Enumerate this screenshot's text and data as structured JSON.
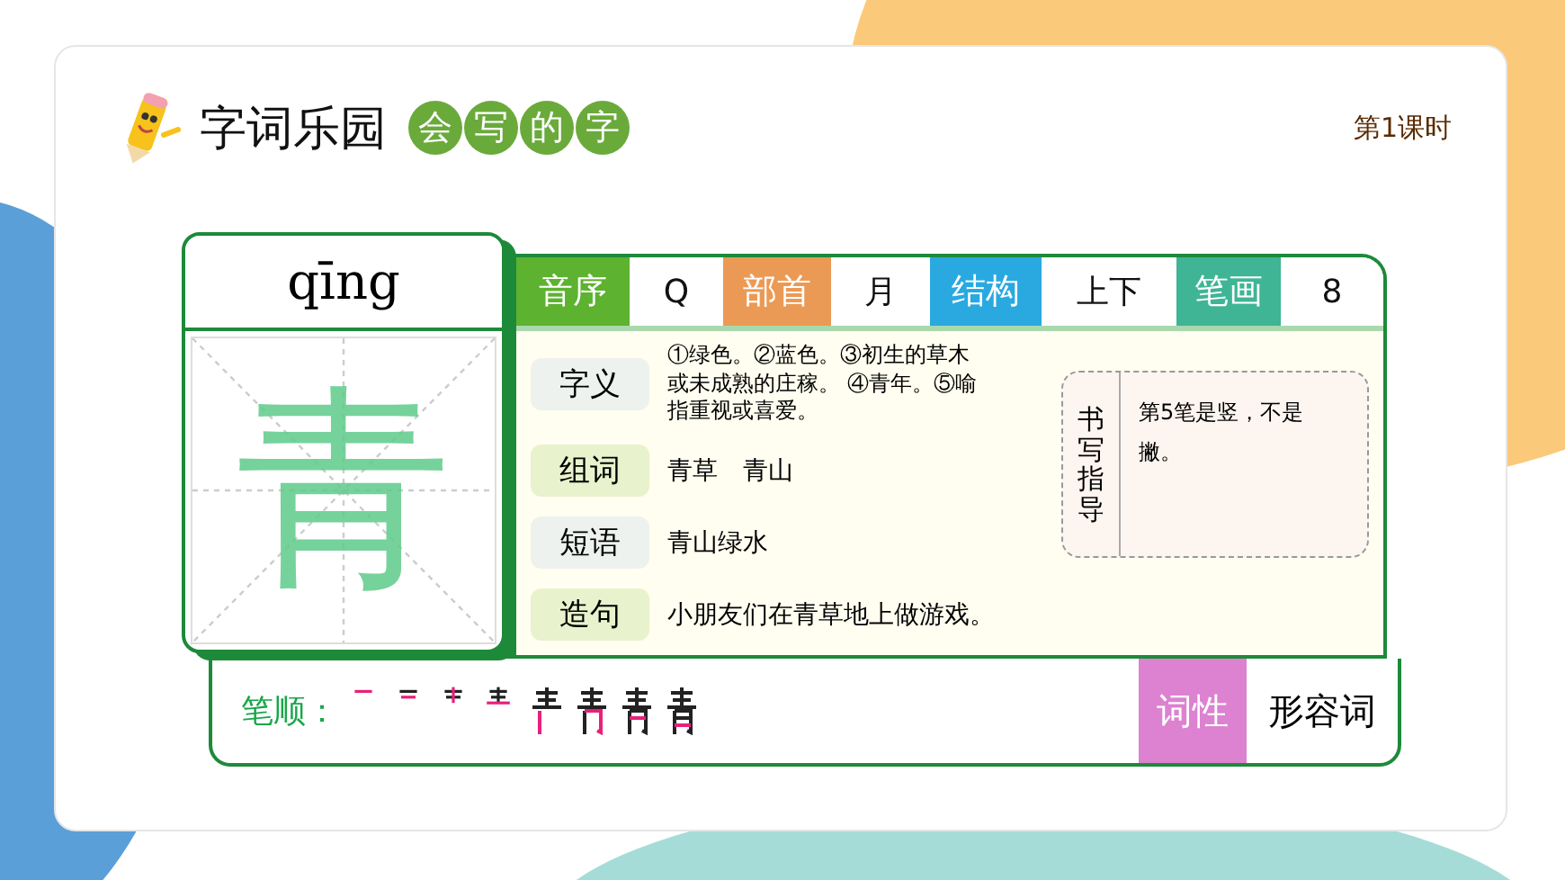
{
  "header": {
    "title": "字词乐园",
    "badges": [
      "会",
      "写",
      "的",
      "字"
    ],
    "lesson": "第1课时"
  },
  "character": {
    "pinyin": "qīng",
    "glyph": "青"
  },
  "facts": [
    {
      "label": "音序",
      "value": "Q",
      "color": "#5db22f"
    },
    {
      "label": "部首",
      "value": "月",
      "color": "#eb9a55"
    },
    {
      "label": "结构",
      "value": "上下",
      "color": "#29a9e0"
    },
    {
      "label": "笔画",
      "value": "8",
      "color": "#3fb595"
    }
  ],
  "entries": [
    {
      "label": "字义",
      "text": "①绿色。②蓝色。③初生的草木或未成熟的庄稼。 ④青年。⑤喻指重视或喜爱。"
    },
    {
      "label": "组词",
      "text": "青草　青山"
    },
    {
      "label": "短语",
      "text": "青山绿水"
    },
    {
      "label": "造句",
      "text": "小朋友们在青草地上做游戏。"
    }
  ],
  "guide": {
    "label": "书写指导",
    "text": "第5笔是竖，不是撇。"
  },
  "stroke_order": {
    "label": "笔顺："
  },
  "part_of_speech": {
    "label": "词性",
    "value": "形容词"
  }
}
